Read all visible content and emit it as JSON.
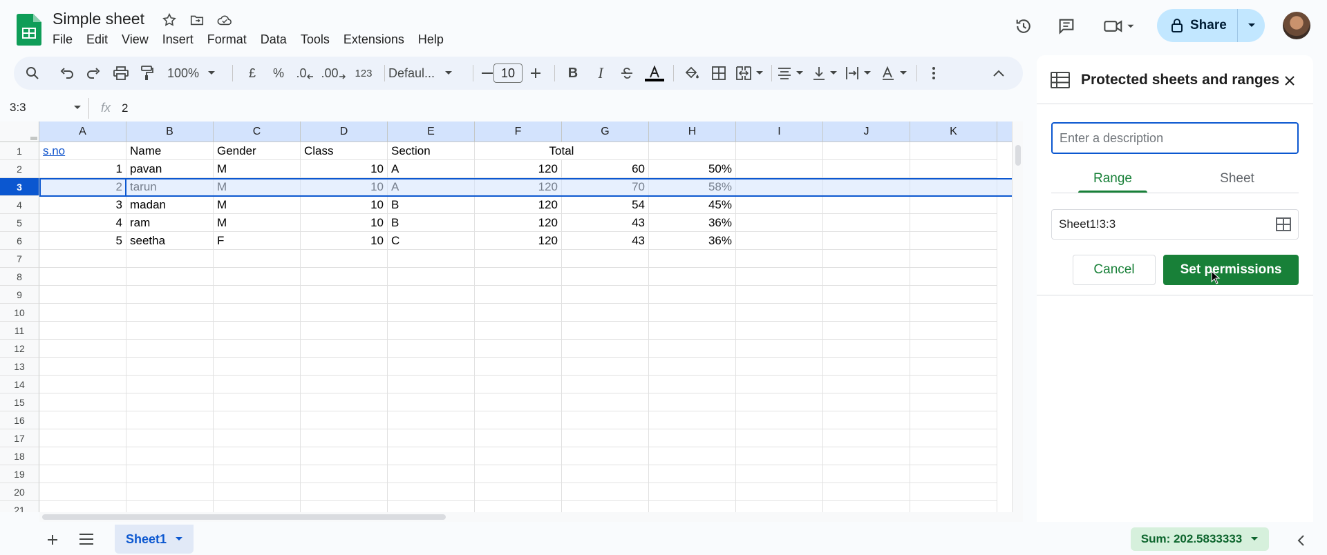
{
  "doc": {
    "title": "Simple sheet"
  },
  "menu": [
    "File",
    "Edit",
    "View",
    "Insert",
    "Format",
    "Data",
    "Tools",
    "Extensions",
    "Help"
  ],
  "share": {
    "label": "Share"
  },
  "toolbar": {
    "zoom": "100%",
    "currency": "£",
    "percent": "%",
    "dec_decrease": ".0",
    "dec_increase": ".00",
    "number_format": "123",
    "font": "Defaul...",
    "font_size": "10"
  },
  "formula_bar": {
    "namebox": "3:3",
    "fx": "fx",
    "value": "2"
  },
  "grid": {
    "columns": [
      "A",
      "B",
      "C",
      "D",
      "E",
      "F",
      "G",
      "H",
      "I",
      "J",
      "K"
    ],
    "rows": [
      "1",
      "2",
      "3",
      "4",
      "5",
      "6",
      "7",
      "8",
      "9",
      "10",
      "11",
      "12",
      "13",
      "14",
      "15",
      "16",
      "17",
      "18",
      "19",
      "20",
      "21"
    ],
    "header_row": {
      "a": "s.no",
      "b": "Name",
      "c": "Gender",
      "d": "Class",
      "e": "Section",
      "fg": "Total"
    },
    "data": [
      {
        "a": "1",
        "b": "pavan",
        "c": "M",
        "d": "10",
        "e": "A",
        "f": "120",
        "g": "60",
        "h": "50%"
      },
      {
        "a": "2",
        "b": "tarun",
        "c": "M",
        "d": "10",
        "e": "A",
        "f": "120",
        "g": "70",
        "h": "58%"
      },
      {
        "a": "3",
        "b": "madan",
        "c": "M",
        "d": "10",
        "e": "B",
        "f": "120",
        "g": "54",
        "h": "45%"
      },
      {
        "a": "4",
        "b": "ram",
        "c": "M",
        "d": "10",
        "e": "B",
        "f": "120",
        "g": "43",
        "h": "36%"
      },
      {
        "a": "5",
        "b": "seetha",
        "c": "F",
        "d": "10",
        "e": "C",
        "f": "120",
        "g": "43",
        "h": "36%"
      }
    ],
    "selected_row": "3"
  },
  "bottom": {
    "sheet_tab": "Sheet1",
    "sum": "Sum: 202.5833333"
  },
  "panel": {
    "title": "Protected sheets and ranges",
    "description_placeholder": "Enter a description",
    "tab_range": "Range",
    "tab_sheet": "Sheet",
    "range_value": "Sheet1!3:3",
    "cancel": "Cancel",
    "set_permissions": "Set permissions"
  },
  "colors": {
    "accent_green": "#188038",
    "selection_blue": "#0b57d0",
    "share_bg": "#c2e7ff"
  }
}
